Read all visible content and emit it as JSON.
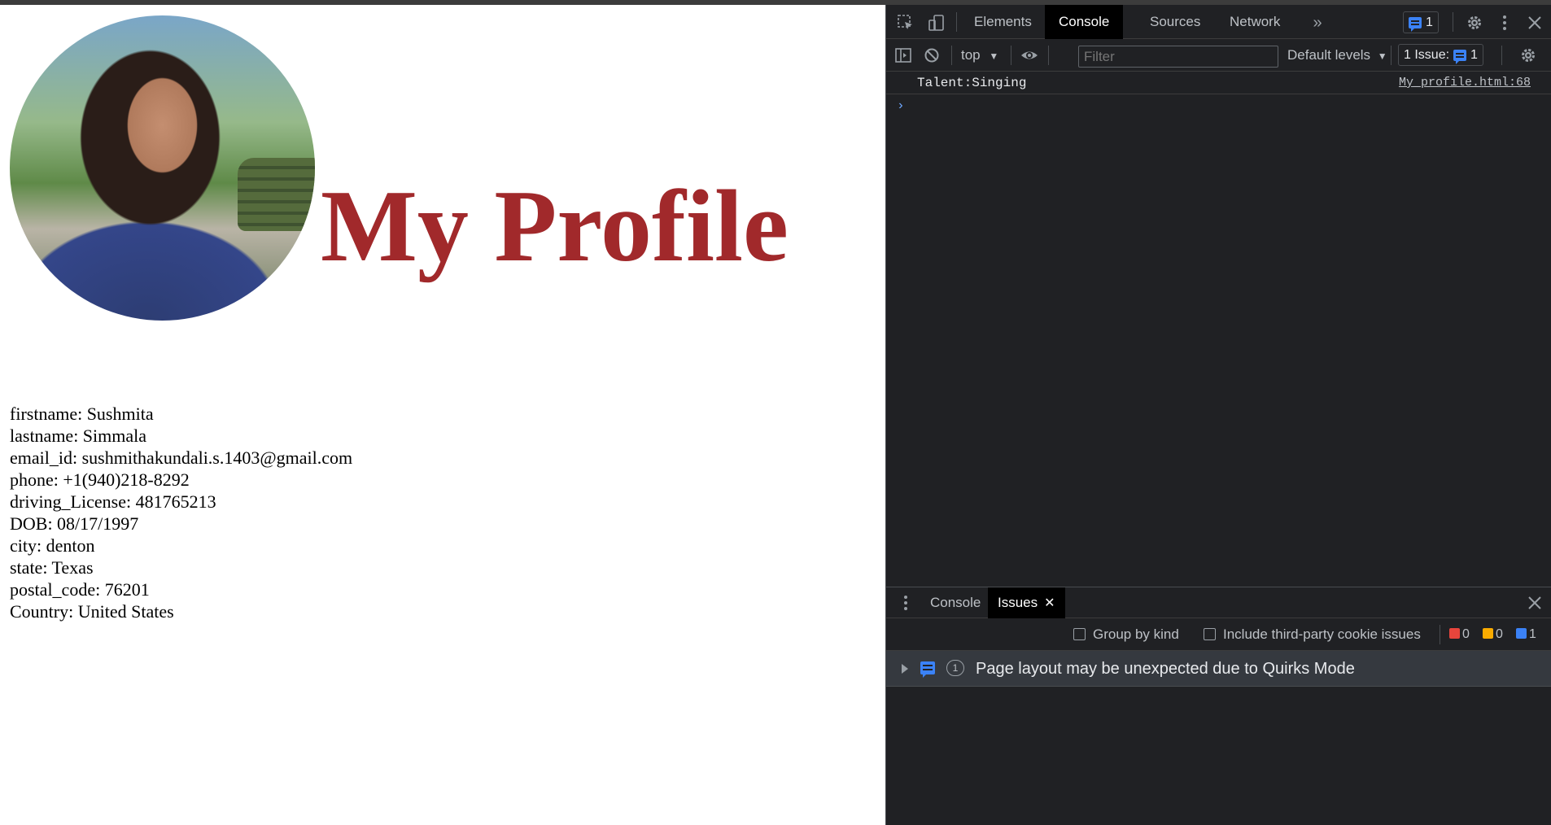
{
  "page": {
    "title": "My Profile",
    "details": [
      "firstname: Sushmita",
      "lastname: Simmala",
      "email_id: sushmithakundali.s.1403@gmail.com",
      "phone: +1(940)218-8292",
      "driving_License: 481765213",
      "DOB: 08/17/1997",
      "city: denton",
      "state: Texas",
      "postal_code: 76201",
      "Country: United States"
    ]
  },
  "devtools": {
    "tabs": [
      "Elements",
      "Console",
      "Sources",
      "Network"
    ],
    "active_tab": "Console",
    "message_badge_count": "1",
    "toolbar": {
      "context": "top",
      "filter_placeholder": "Filter",
      "levels": "Default levels",
      "issues_label": "1 Issue:",
      "issues_count": "1"
    },
    "console": {
      "message": "Talent:Singing",
      "source": "My_profile.html:68",
      "prompt": "›"
    },
    "drawer": {
      "tabs": [
        "Console",
        "Issues"
      ],
      "active_tab": "Issues",
      "group_by_kind": "Group by kind",
      "third_party": "Include third-party cookie issues",
      "errors": "0",
      "warnings": "0",
      "info": "1",
      "issue_count": "1",
      "issue_text": "Page layout may be unexpected due to Quirks Mode"
    }
  },
  "colors": {
    "title": "#a1292b",
    "devtools_bg": "#202124",
    "accent_blue": "#3b82f6",
    "error_red": "#e8453c",
    "warning_yellow": "#f9ab00"
  },
  "icons": [
    "inspect-icon",
    "device-toolbar-icon",
    "more-tabs-icon",
    "settings-icon",
    "kebab-menu-icon",
    "close-icon",
    "sidebar-toggle-icon",
    "clear-console-icon",
    "eye-icon",
    "chevron-down-icon"
  ]
}
